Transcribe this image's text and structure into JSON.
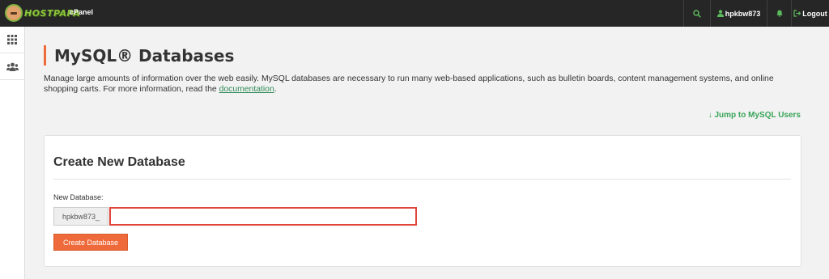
{
  "topbar": {
    "logo_text": "HOSTPAPA",
    "product": "cPanel",
    "search_icon": "search-icon",
    "username": "hpkbw873",
    "user_icon": "user-icon",
    "bell_icon": "bell-icon",
    "logout_label": "Logout",
    "logout_icon": "logout-icon",
    "accent": "#5cb85c"
  },
  "sidebar": {
    "items": [
      {
        "icon": "grid-icon"
      },
      {
        "icon": "users-icon"
      }
    ]
  },
  "page": {
    "title": "MySQL® Databases",
    "description_pre": "Manage large amounts of information over the web easily. MySQL databases are necessary to run many web-based applications, such as bulletin boards, content management systems, and online shopping carts. For more information, read the ",
    "doc_link": "documentation",
    "description_post": ".",
    "jump_link": "↓ Jump to MySQL Users"
  },
  "create_panel": {
    "title": "Create New Database",
    "field_label": "New Database:",
    "prefix": "hpkbw873_",
    "input_value": "",
    "input_placeholder": "",
    "button_label": "Create Database",
    "button_color": "#ef6a3a",
    "highlight_color": "#e0453a"
  }
}
